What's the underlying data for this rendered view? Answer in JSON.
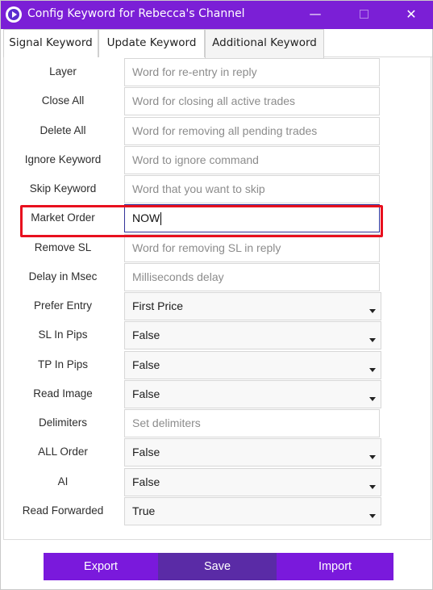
{
  "window": {
    "title": "Config Keyword for Rebecca's Channel",
    "minimize_glyph": "—",
    "close_glyph": "✕"
  },
  "tabs": [
    {
      "label": "Signal Keyword",
      "active": false
    },
    {
      "label": "Update Keyword",
      "active": false
    },
    {
      "label": "Additional Keyword",
      "active": true
    }
  ],
  "rows": [
    {
      "label": "Layer",
      "type": "text",
      "value": "",
      "placeholder": "Word for re-entry in reply"
    },
    {
      "label": "Close All",
      "type": "text",
      "value": "",
      "placeholder": "Word for closing all active trades"
    },
    {
      "label": "Delete All",
      "type": "text",
      "value": "",
      "placeholder": "Word for removing all pending trades"
    },
    {
      "label": "Ignore Keyword",
      "type": "text",
      "value": "",
      "placeholder": "Word to ignore command"
    },
    {
      "label": "Skip Keyword",
      "type": "text",
      "value": "",
      "placeholder": "Word that you want to skip"
    },
    {
      "label": "Market Order",
      "type": "text",
      "value": "NOW",
      "placeholder": "",
      "focused": true,
      "highlighted": true
    },
    {
      "label": "Remove SL",
      "type": "text",
      "value": "",
      "placeholder": "Word for removing SL in reply"
    },
    {
      "label": "Delay in Msec",
      "type": "text",
      "value": "",
      "placeholder": "Milliseconds delay"
    },
    {
      "label": "Prefer Entry",
      "type": "select",
      "value": "First Price"
    },
    {
      "label": "SL In Pips",
      "type": "select",
      "value": "False"
    },
    {
      "label": "TP In Pips",
      "type": "select",
      "value": "False"
    },
    {
      "label": "Read Image",
      "type": "select",
      "value": "False"
    },
    {
      "label": "Delimiters",
      "type": "text",
      "value": "",
      "placeholder": "Set delimiters"
    },
    {
      "label": "ALL Order",
      "type": "select",
      "value": "False"
    },
    {
      "label": "AI",
      "type": "select",
      "value": "False"
    },
    {
      "label": "Read Forwarded",
      "type": "select",
      "value": "True"
    }
  ],
  "footer": {
    "export_label": "Export",
    "save_label": "Save",
    "import_label": "Import"
  },
  "colors": {
    "titlebar": "#7b1fd6",
    "button_primary": "#7a19dc",
    "button_save": "#5a2ba6",
    "highlight_border": "#e8101e"
  }
}
